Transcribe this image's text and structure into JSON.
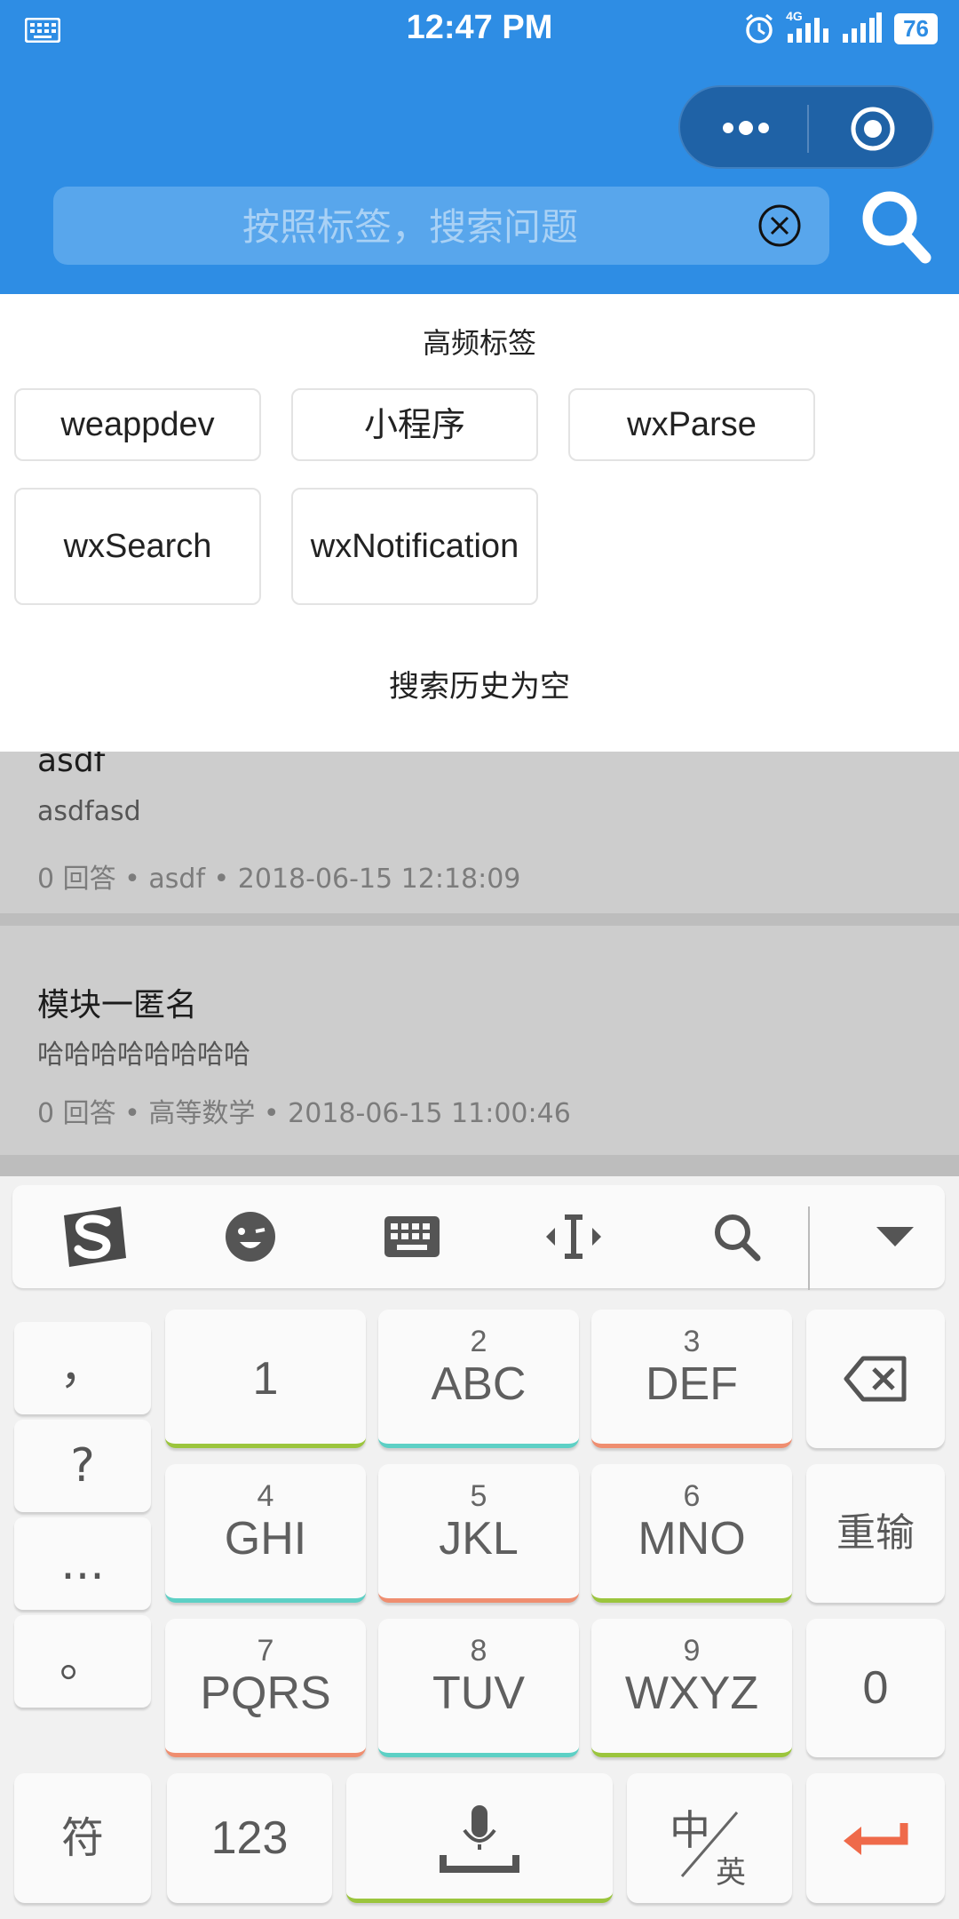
{
  "status_bar": {
    "time": "12:47 PM",
    "battery": "76",
    "net_label": "4G"
  },
  "search": {
    "placeholder": "按照标签，搜索问题",
    "value": ""
  },
  "panel": {
    "title": "高频标签",
    "tags": [
      "weappdev",
      "小程序",
      "wxParse",
      "wxSearch",
      "wxNotification"
    ],
    "history_empty": "搜索历史为空"
  },
  "questions": [
    {
      "title": "asdf",
      "body": "asdfasd",
      "meta": "0 回答 • asdf • 2018-06-15 12:18:09"
    },
    {
      "title": "模块一匿名",
      "body": "哈哈哈哈哈哈哈哈",
      "meta": "0 回答 • 高等数学 • 2018-06-15 11:00:46"
    }
  ],
  "keyboard": {
    "toolbar": [
      "sogou-logo",
      "emoji",
      "keyboard",
      "cursor",
      "search",
      "collapse"
    ],
    "side_keys": [
      "，",
      "?",
      "...",
      "。"
    ],
    "keys": [
      {
        "num": "",
        "letters": "1"
      },
      {
        "num": "2",
        "letters": "ABC"
      },
      {
        "num": "3",
        "letters": "DEF"
      },
      {
        "num": "4",
        "letters": "GHI"
      },
      {
        "num": "5",
        "letters": "JKL"
      },
      {
        "num": "6",
        "letters": "MNO"
      },
      {
        "num": "7",
        "letters": "PQRS"
      },
      {
        "num": "8",
        "letters": "TUV"
      },
      {
        "num": "9",
        "letters": "WXYZ"
      }
    ],
    "reinput": "重输",
    "zero": "0",
    "symbols": "符",
    "numbers": "123",
    "lang_main": "中",
    "lang_sub": "英"
  },
  "colors": {
    "header_blue": "#2e8de4",
    "enter_orange": "#ef6a4a"
  }
}
